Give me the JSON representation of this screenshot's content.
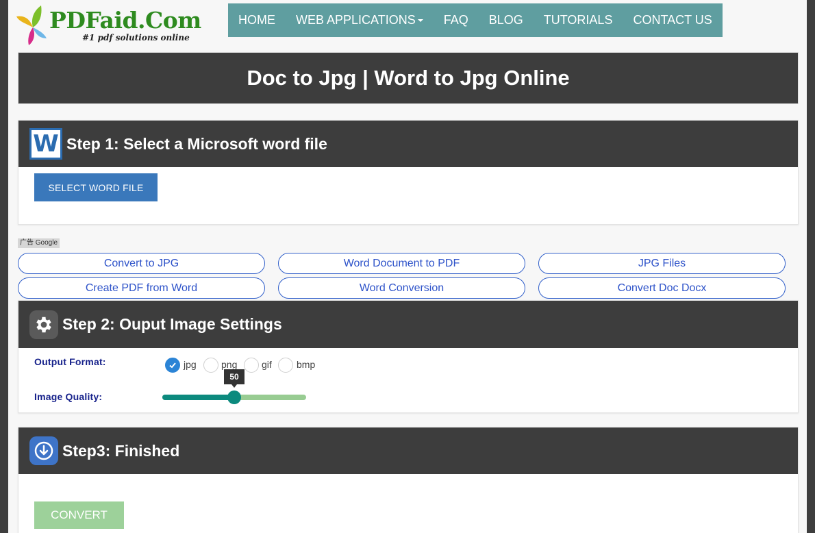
{
  "logo": {
    "name": "PDFaid.Com",
    "tagline": "#1 pdf solutions online"
  },
  "nav": {
    "items": [
      {
        "label": "HOME"
      },
      {
        "label": "WEB APPLICATIONS",
        "dropdown": true
      },
      {
        "label": "FAQ"
      },
      {
        "label": "BLOG"
      },
      {
        "label": "TUTORIALS"
      },
      {
        "label": "CONTACT US"
      }
    ]
  },
  "page_title": "Doc to Jpg | Word to Jpg Online",
  "step1": {
    "title": "Step 1: Select a Microsoft word file",
    "icon_letter": "W",
    "button": "SELECT WORD FILE"
  },
  "ads": {
    "tag": "广告 Google",
    "links": [
      "Convert to JPG",
      "Word Document to PDF",
      "JPG Files",
      "Create PDF from Word",
      "Word Conversion",
      "Convert Doc Docx"
    ]
  },
  "step2": {
    "title": "Step 2: Ouput Image Settings",
    "output_format_label": "Output Format:",
    "formats": [
      "jpg",
      "png",
      "gif",
      "bmp"
    ],
    "selected_format": "jpg",
    "quality_label": "Image Quality:",
    "quality_value": "50",
    "quality_fraction": 0.5
  },
  "step3": {
    "title": "Step3: Finished",
    "button": "CONVERT"
  },
  "colors": {
    "nav_bg": "#5f9ea0",
    "panel_header": "#3d3d3d",
    "select_button": "#3a78bb",
    "convert_button": "#9dd19a",
    "slider_fill": "#0c8a7e",
    "slider_track": "#98cc92",
    "link_text": "#2d52c9",
    "label_text": "#15208a"
  },
  "icons": {
    "word": "word-icon",
    "settings": "gear-icon",
    "download": "download-icon"
  }
}
